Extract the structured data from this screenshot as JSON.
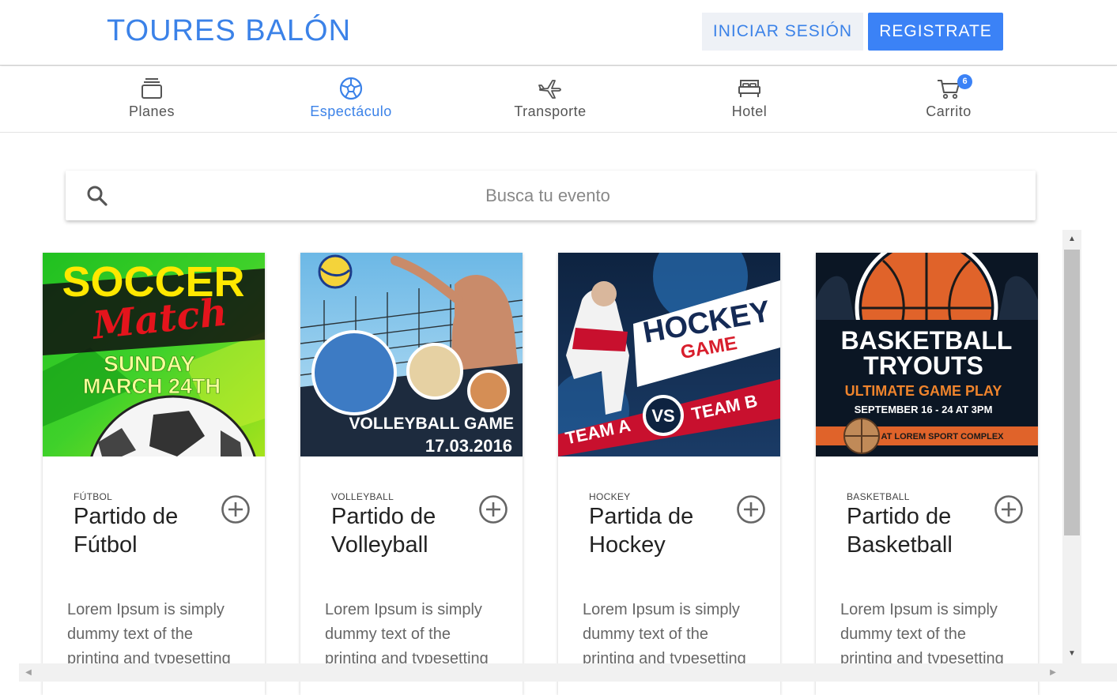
{
  "header": {
    "brand": "TOURES BALÓN",
    "login_label": "INICIAR SESIÓN",
    "register_label": "REGISTRATE"
  },
  "nav": {
    "items": [
      {
        "label": "Planes",
        "icon": "layers-icon"
      },
      {
        "label": "Espectáculo",
        "icon": "soccer-ball-icon",
        "active": true
      },
      {
        "label": "Transporte",
        "icon": "airplane-icon"
      },
      {
        "label": "Hotel",
        "icon": "bed-icon"
      },
      {
        "label": "Carrito",
        "icon": "cart-icon",
        "badge": "6"
      }
    ]
  },
  "search": {
    "placeholder": "Busca tu evento"
  },
  "cards": [
    {
      "category": "FÚTBOL",
      "title": "Partido de Fútbol",
      "description": "Lorem Ipsum is simply dummy text of the printing and typesetting",
      "poster": {
        "line1": "SOCCER",
        "line2": "Match",
        "line3": "SUNDAY",
        "line4": "MARCH 24TH"
      }
    },
    {
      "category": "VOLLEYBALL",
      "title": "Partido de Volleyball",
      "description": "Lorem Ipsum is simply dummy text of the printing and typesetting",
      "poster": {
        "line1": "VOLLEYBALL GAME",
        "line2": "17.03.2016"
      }
    },
    {
      "category": "HOCKEY",
      "title": "Partida de Hockey",
      "description": "Lorem Ipsum is simply dummy text of the printing and typesetting",
      "poster": {
        "line1": "HOCKEY",
        "line2": "GAME",
        "line3": "TEAM A",
        "line4": "VS",
        "line5": "TEAM B"
      }
    },
    {
      "category": "BASKETBALL",
      "title": "Partido de Basketball",
      "description": "Lorem Ipsum is simply dummy text of the printing and typesetting",
      "poster": {
        "line1": "BASKETBALL",
        "line2": "TRYOUTS",
        "line3": "ULTIMATE GAME PLAY",
        "line4": "SEPTEMBER 16 - 24 AT 3PM",
        "line5": "AT LOREM SPORT COMPLEX"
      }
    }
  ],
  "colors": {
    "accent": "#3b82f6",
    "brand": "#3b82e8"
  }
}
